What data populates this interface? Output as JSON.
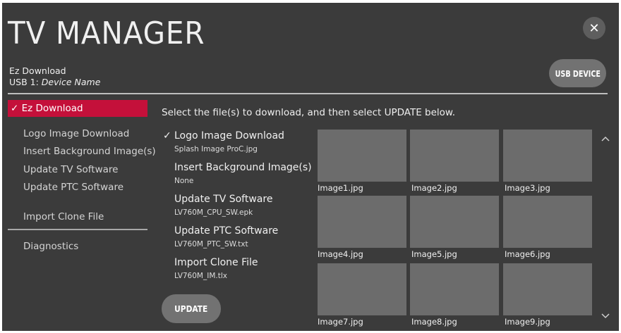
{
  "header": {
    "title": "TV MANAGER",
    "section": "Ez Download",
    "usb_prefix": "USB 1: ",
    "device_name": "Device Name",
    "usb_button": "USB DEVICE",
    "close_glyph": "✕"
  },
  "menu": {
    "active_label": "✓ Ez Download",
    "items": [
      "Logo Image Download",
      "Insert Background Image(s)",
      "Update TV Software",
      "Update PTC Software",
      "Import Clone File",
      "Diagnostics"
    ]
  },
  "main": {
    "instruction": "Select the file(s) to download, and then select UPDATE below.",
    "check_glyph": "✓",
    "files": [
      {
        "label": "Logo Image Download",
        "file": "Splash Image ProC.jpg",
        "checked": true
      },
      {
        "label": "Insert Background Image(s)",
        "file": "None",
        "checked": false
      },
      {
        "label": "Update TV Software",
        "file": "LV760M_CPU_SW.epk",
        "checked": false
      },
      {
        "label": "Update PTC Software",
        "file": "LV760M_PTC_SW.txt",
        "checked": false
      },
      {
        "label": "Import Clone File",
        "file": "LV760M_IM.tlx",
        "checked": false
      }
    ],
    "update_button": "UPDATE"
  },
  "gallery": {
    "images": [
      "Image1.jpg",
      "Image2.jpg",
      "Image3.jpg",
      "Image4.jpg",
      "Image5.jpg",
      "Image6.jpg",
      "Image7.jpg",
      "Image8.jpg",
      "Image9.jpg"
    ],
    "scroll_up_icon": "chevron-up-icon",
    "scroll_down_icon": "chevron-down-icon"
  },
  "colors": {
    "background": "#3b3b3b",
    "accent": "#c4103a",
    "button": "#727272",
    "thumbnail": "#6c6c6c"
  }
}
